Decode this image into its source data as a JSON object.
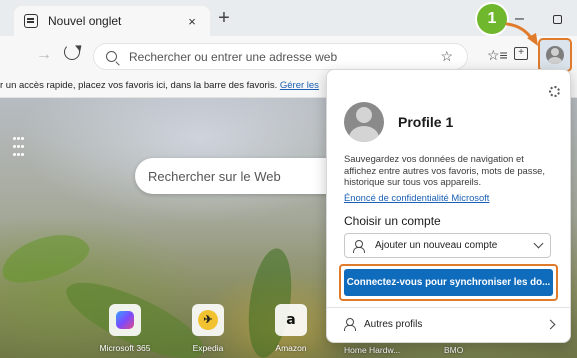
{
  "tab": {
    "title": "Nouvel onglet",
    "close": "×",
    "new_tab": "+"
  },
  "window": {
    "minimize": "–"
  },
  "nav": {
    "forward": "→",
    "address_placeholder": "Rechercher ou entrer une adresse web",
    "fav_add": "☆",
    "favorites": "☆≡",
    "collections": "+"
  },
  "favorites_bar": {
    "text": "r un accès rapide, placez vos favoris ici, dans la barre des favoris.",
    "link": "Gérer les"
  },
  "page": {
    "search_placeholder": "Rechercher sur le Web",
    "quick_links": [
      {
        "label": "Microsoft 365"
      },
      {
        "label": "Expedia"
      },
      {
        "label": "Amazon",
        "glyph": "a"
      }
    ],
    "extra_links": [
      "Home Hardw...",
      "BMO"
    ]
  },
  "profile_panel": {
    "name": "Profile 1",
    "description": "Sauvegardez vos données de navigation et affichez entre autres vos favoris, mots de passe, historique sur tous vos appareils.",
    "privacy_link": "Énoncé de confidentialité Microsoft",
    "choose_account": "Choisir un compte",
    "add_account": "Ajouter un nouveau compte",
    "sync_button": "Connectez-vous pour synchroniser les do...",
    "other_profiles": "Autres profils"
  },
  "annotation": {
    "step": "1",
    "accent_color": "#e07b2b",
    "badge_color": "#6fb82d"
  }
}
